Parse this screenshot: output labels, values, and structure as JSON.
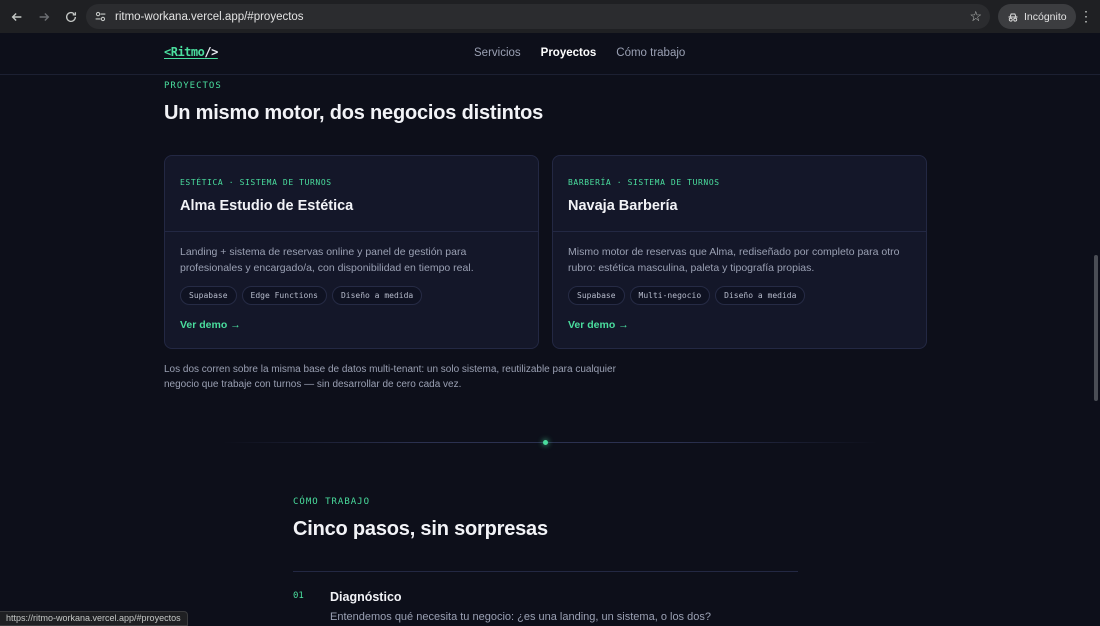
{
  "browser": {
    "url": "ritmo-workana.vercel.app/#proyectos",
    "incognito_label": "Incógnito",
    "status_url": "https://ritmo-workana.vercel.app/#proyectos"
  },
  "site": {
    "logo": {
      "prefix": "<Ritmo",
      "suffix": "/>"
    },
    "nav": [
      {
        "label": "Servicios",
        "active": false
      },
      {
        "label": "Proyectos",
        "active": true
      },
      {
        "label": "Cómo trabajo",
        "active": false
      }
    ]
  },
  "projects": {
    "eyebrow": "PROYECTOS",
    "title": "Un mismo motor, dos negocios distintos",
    "cards": [
      {
        "tag": "ESTÉTICA · SISTEMA DE TURNOS",
        "title": "Alma Estudio de Estética",
        "description": "Landing + sistema de reservas online y panel de gestión para profesionales y encargado/a, con disponibilidad en tiempo real.",
        "chips": [
          "Supabase",
          "Edge Functions",
          "Diseño a medida"
        ],
        "link": "Ver demo →"
      },
      {
        "tag": "BARBERÍA · SISTEMA DE TURNOS",
        "title": "Navaja Barbería",
        "description": "Mismo motor de reservas que Alma, rediseñado por completo para otro rubro: estética masculina, paleta y tipografía propias.",
        "chips": [
          "Supabase",
          "Multi-negocio",
          "Diseño a medida"
        ],
        "link": "Ver demo →"
      }
    ],
    "note": "Los dos corren sobre la misma base de datos multi-tenant: un solo sistema, reutilizable para cualquier negocio que trabaje con turnos — sin desarrollar de cero cada vez."
  },
  "process": {
    "eyebrow": "CÓMO TRABAJO",
    "title": "Cinco pasos, sin sorpresas",
    "steps": [
      {
        "number": "01",
        "title": "Diagnóstico",
        "description": "Entendemos qué necesita tu negocio: ¿es una landing, un sistema, o los dos?"
      }
    ]
  },
  "colors": {
    "accent": "#4ade9e",
    "background": "#0d0f1a",
    "card": "#141729"
  }
}
